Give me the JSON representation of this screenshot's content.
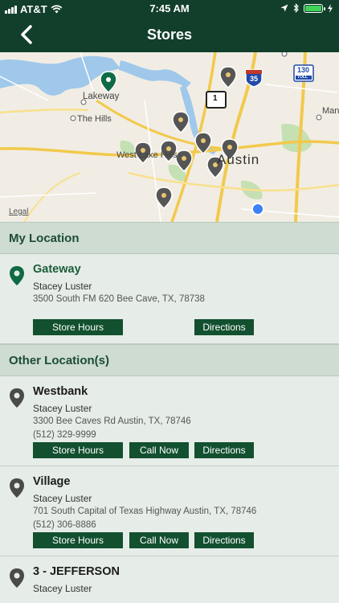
{
  "status_bar": {
    "carrier": "AT&T",
    "time": "7:45 AM"
  },
  "header": {
    "title": "Stores"
  },
  "map": {
    "labels": {
      "lakeway": "Lakeway",
      "the_hills": "The Hills",
      "westlake": "West Lake Hills",
      "austin": "Austin",
      "manor": "Man",
      "hwy35": "35",
      "hwy130": "130",
      "hwy1": "1",
      "toll": "TOLL"
    },
    "legal": "Legal"
  },
  "my_location": {
    "section_label": "My Location",
    "store": {
      "name": "Gateway",
      "contact": "Stacey Luster",
      "address": "3500 South FM 620 Bee Cave, TX, 78738",
      "hours_label": "Store Hours",
      "directions_label": "Directions"
    }
  },
  "other_locations": {
    "section_label": "Other Location(s)",
    "stores": [
      {
        "name": "Westbank",
        "contact": "Stacey Luster",
        "address": "3300 Bee Caves Rd Austin, TX, 78746",
        "phone": "(512) 329-9999",
        "hours_label": "Store Hours",
        "call_label": "Call Now",
        "directions_label": "Directions"
      },
      {
        "name": "Village",
        "contact": "Stacey Luster",
        "address": "701 South Capital of Texas Highway Austin, TX, 78746",
        "phone": "(512) 306-8886",
        "hours_label": "Store Hours",
        "call_label": "Call Now",
        "directions_label": "Directions"
      },
      {
        "name": "3 - JEFFERSON",
        "contact": "Stacey Luster"
      }
    ]
  },
  "colors": {
    "header": "#123f2c",
    "button": "#12502f",
    "section": "#cfdcd2",
    "pin_active": "#0f6b45",
    "pin": "#555555"
  }
}
